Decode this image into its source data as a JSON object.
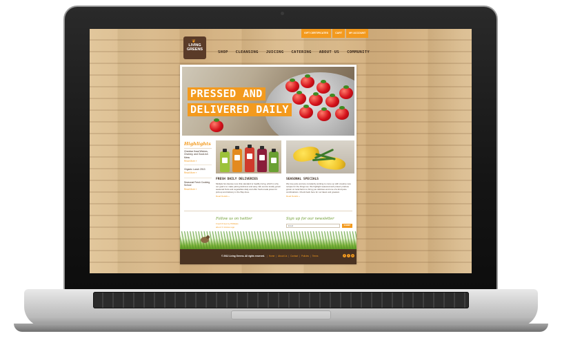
{
  "site": {
    "brand_line1": "LIVING",
    "brand_line2": "GREENS",
    "utility_links": [
      "GIFT CERTIFICATES",
      "CART",
      "MY ACCOUNT"
    ],
    "nav": [
      "SHOP",
      "CLEANSING",
      "JUICING",
      "CATERING",
      "ABOUT US",
      "COMMUNITY"
    ]
  },
  "hero": {
    "line1": "PRESSED AND",
    "line2": "DELIVERED DAILY"
  },
  "sidebar": {
    "title": "Highlights",
    "items": [
      {
        "text": "Cheddar Kraut'Wiches, Chutney, and Good-ish Mess",
        "more": "Read More »"
      },
      {
        "text": "Organic Lunch 2013",
        "more": "Read More »"
      },
      {
        "text": "Seasonal Fresh Cooking School",
        "more": "Read More »"
      }
    ]
  },
  "features": [
    {
      "heading": "FRESH DAILY DELIVERIES",
      "body": "Multiple fat cleanse new chia standard to healthy living, which is why our goal is to make juicing delicious and easy. We source locally grown seasonal fruits and vegetables daily and offer fresh-made juices for pick-up and delivery in the Bay Area.",
      "more": "Read Details »"
    },
    {
      "heading": "SEASONAL SPECIALS",
      "body": "We love juice and are constantly working to come up with creative new recipes for the things we. We highlight seasonal and protect produce grown on local farms to bring you delicious and one of a kind juice combinations. Check back here for our latest and greatest.",
      "more": "Read Details »"
    }
  ],
  "twitter": {
    "heading": "Follow us on twitter",
    "lines": [
      "Fresh fit tips by #SFEats",
      "about 3 minutes ago"
    ]
  },
  "newsletter": {
    "heading": "Sign up for our newsletter",
    "placeholder": "Email",
    "submit": "SUBMIT"
  },
  "footer": {
    "copyright": "© 2012 Living Greens. All rights reserved.",
    "links": [
      "Home",
      "About Us",
      "Contact",
      "Policies",
      "Terms"
    ],
    "social": [
      "f",
      "t",
      "p"
    ]
  },
  "colors": {
    "accent": "#f39a1e",
    "brown": "#4a3322",
    "green": "#6a9a2c"
  }
}
